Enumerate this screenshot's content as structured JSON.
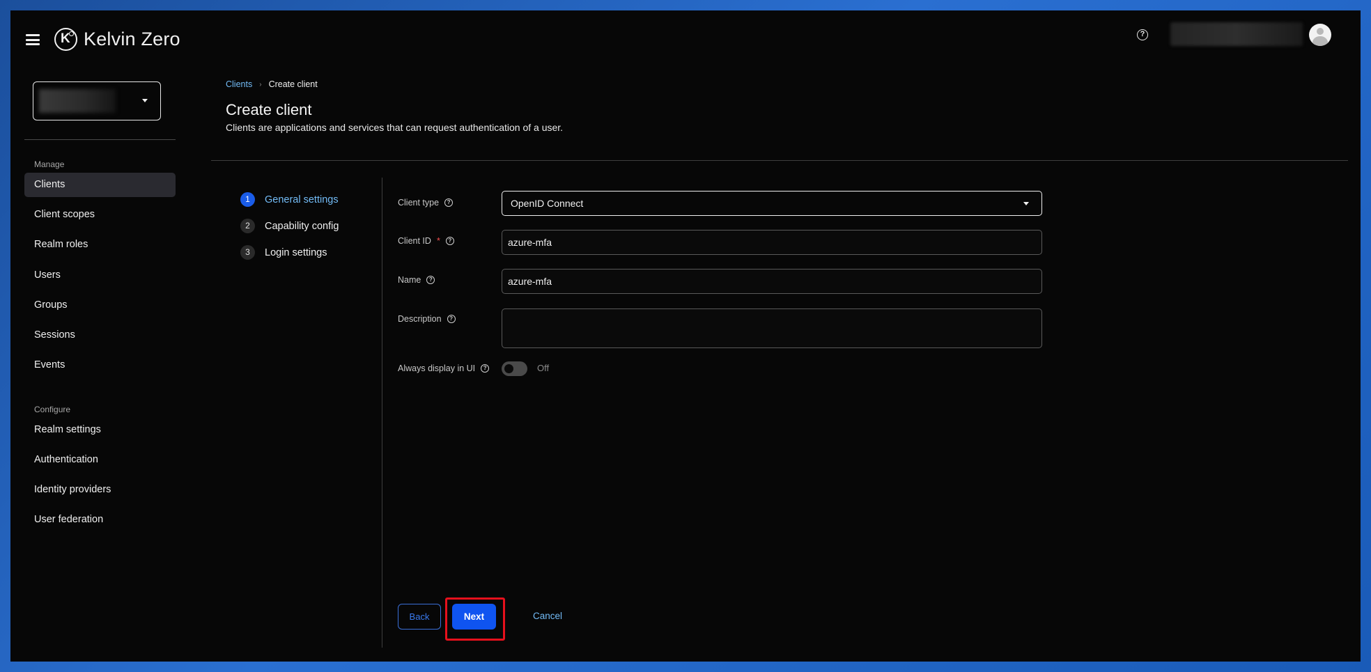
{
  "app": {
    "brand": "Kelvin Zero"
  },
  "sidebar": {
    "manage_heading": "Manage",
    "manage_items": [
      {
        "label": "Clients",
        "active": true
      },
      {
        "label": "Client scopes"
      },
      {
        "label": "Realm roles"
      },
      {
        "label": "Users"
      },
      {
        "label": "Groups"
      },
      {
        "label": "Sessions"
      },
      {
        "label": "Events"
      }
    ],
    "configure_heading": "Configure",
    "configure_items": [
      {
        "label": "Realm settings"
      },
      {
        "label": "Authentication"
      },
      {
        "label": "Identity providers"
      },
      {
        "label": "User federation"
      }
    ]
  },
  "breadcrumb": {
    "parent": "Clients",
    "separator": "›",
    "current": "Create client"
  },
  "page": {
    "title": "Create client",
    "description": "Clients are applications and services that can request authentication of a user."
  },
  "wizard": {
    "steps": [
      {
        "num": "1",
        "label": "General settings",
        "active": true
      },
      {
        "num": "2",
        "label": "Capability config"
      },
      {
        "num": "3",
        "label": "Login settings"
      }
    ]
  },
  "form": {
    "client_type": {
      "label": "Client type",
      "value": "OpenID Connect"
    },
    "client_id": {
      "label": "Client ID",
      "required_mark": "*",
      "value": "azure-mfa"
    },
    "name": {
      "label": "Name",
      "value": "azure-mfa"
    },
    "description": {
      "label": "Description",
      "value": ""
    },
    "always_display": {
      "label": "Always display in UI",
      "state_text": "Off"
    }
  },
  "actions": {
    "back": "Back",
    "next": "Next",
    "cancel": "Cancel"
  },
  "icons": {
    "help": "question-circle-icon",
    "menu": "hamburger-icon",
    "avatar": "user-avatar-icon"
  },
  "colors": {
    "accent": "#0f54f0",
    "link": "#73bcf7",
    "highlight": "#e6101c",
    "background": "#070707"
  }
}
